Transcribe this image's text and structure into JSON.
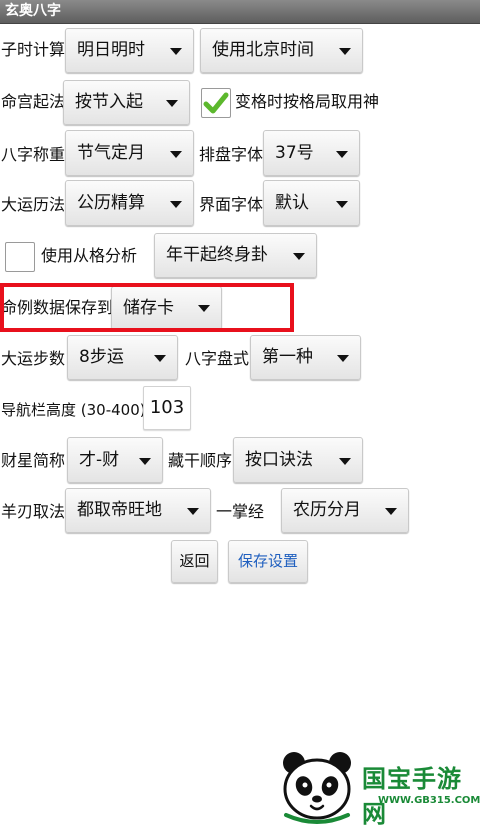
{
  "app": {
    "title": "玄奥八字"
  },
  "settings": {
    "zishi": {
      "label": "子时计算",
      "value1": "明日明时",
      "value2": "使用北京时间"
    },
    "minggong": {
      "label": "命宫起法",
      "value": "按节入起",
      "check_label": "变格时按格局取用神",
      "checked": true
    },
    "bazi_weight": {
      "label": "八字称重",
      "value": "节气定月",
      "font_label": "排盘字体",
      "font_value": "37号"
    },
    "dayun_calendar": {
      "label": "大运历法",
      "value": "公历精算",
      "ui_font_label": "界面字体",
      "ui_font_value": "默认"
    },
    "congge": {
      "check_label": "使用从格分析",
      "checked": false,
      "value": "年干起终身卦"
    },
    "save_case": {
      "label": "命例数据保存到",
      "value": "储存卡"
    },
    "dayun_steps": {
      "label": "大运步数",
      "value": "8步运",
      "pan_label": "八字盘式",
      "pan_value": "第一种"
    },
    "nav_height": {
      "label": "导航栏高度 (30-400)",
      "value": "103"
    },
    "caixing": {
      "label": "财星简称",
      "value": "才-财",
      "canggan_label": "藏干顺序",
      "canggan_value": "按口诀法"
    },
    "yangren": {
      "label": "羊刃取法",
      "value": "都取帝旺地",
      "yizhang_label": "一掌经",
      "yizhang_value": "农历分月"
    }
  },
  "buttons": {
    "back": "返回",
    "save": "保存设置"
  },
  "watermark": {
    "name": "国宝手游网",
    "url": "WWW.GB315.COM"
  },
  "colors": {
    "highlight": "#e8101c",
    "check": "#5cb82d",
    "save_text": "#1f5fbf",
    "watermark": "#1a8a37"
  }
}
